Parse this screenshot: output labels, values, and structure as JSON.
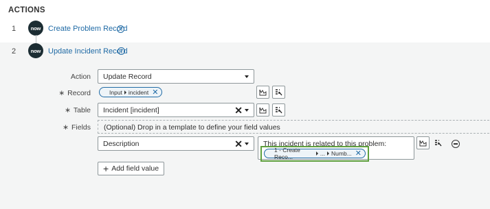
{
  "heading": "ACTIONS",
  "steps": [
    {
      "number": "1",
      "icon_text": "now",
      "title": "Create Problem Record"
    },
    {
      "number": "2",
      "icon_text": "now",
      "title": "Update Incident Record"
    }
  ],
  "form": {
    "action": {
      "label": "Action",
      "value": "Update Record"
    },
    "record": {
      "label": "Record",
      "pill_part1": "Input",
      "pill_part2": "incident"
    },
    "table": {
      "label": "Table",
      "value": "Incident [incident]"
    },
    "fields": {
      "label": "Fields",
      "dropzone_text": "(Optional) Drop in a template to define your field values"
    },
    "field_row": {
      "field_name": "Description",
      "value_text": "This incident is related to this problem:",
      "pill_part1": "1 - Create Reco...",
      "pill_part2": "...",
      "pill_part3": "Numb..."
    },
    "add_field_button": "Add field value"
  },
  "colors": {
    "link": "#1f6aa5",
    "highlight_border": "#5e9f3d",
    "now_badge": "#1c2d33"
  }
}
